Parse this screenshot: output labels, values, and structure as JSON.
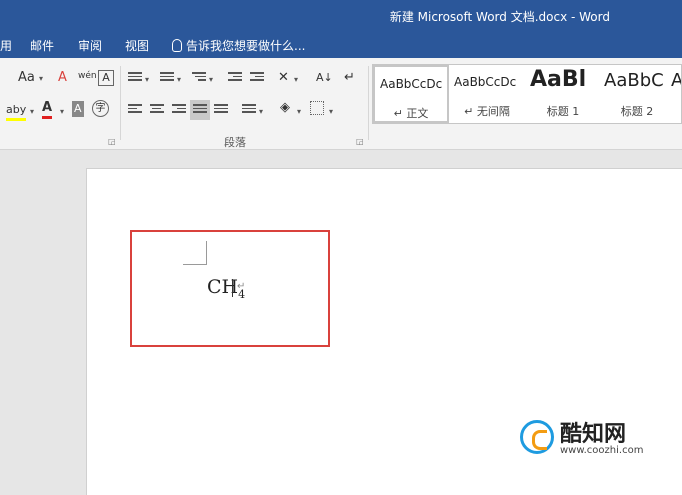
{
  "window": {
    "title": "新建 Microsoft Word 文档.docx - Word"
  },
  "menu": {
    "tabs": [
      "用",
      "邮件",
      "审阅",
      "视图"
    ],
    "tell_me": "告诉我您想要做什么..."
  },
  "ribbon": {
    "font_group": {
      "font_size_label": "Aa",
      "clear_format": "A",
      "phonetic": "wén",
      "char_border": "A",
      "highlight": "aby",
      "font_color": "A",
      "char_shading": "A",
      "enclose": "字"
    },
    "paragraph_group": {
      "label": "段落",
      "sort": "A↓",
      "pilcrow": "↵"
    },
    "styles": [
      {
        "preview": "AaBbCcDc",
        "name": "↵ 正文"
      },
      {
        "preview": "AaBbCcDc",
        "name": "↵ 无间隔"
      },
      {
        "preview": "AaBl",
        "name": "标题 1"
      },
      {
        "preview": "AaBbC",
        "name": "标题 2"
      },
      {
        "preview": "A",
        "name": ""
      }
    ]
  },
  "document": {
    "formula_main": "CH",
    "formula_sub": "4",
    "paragraph_mark": "↵"
  },
  "watermark": {
    "name": "酷知网",
    "url": "www.coozhi.com"
  }
}
